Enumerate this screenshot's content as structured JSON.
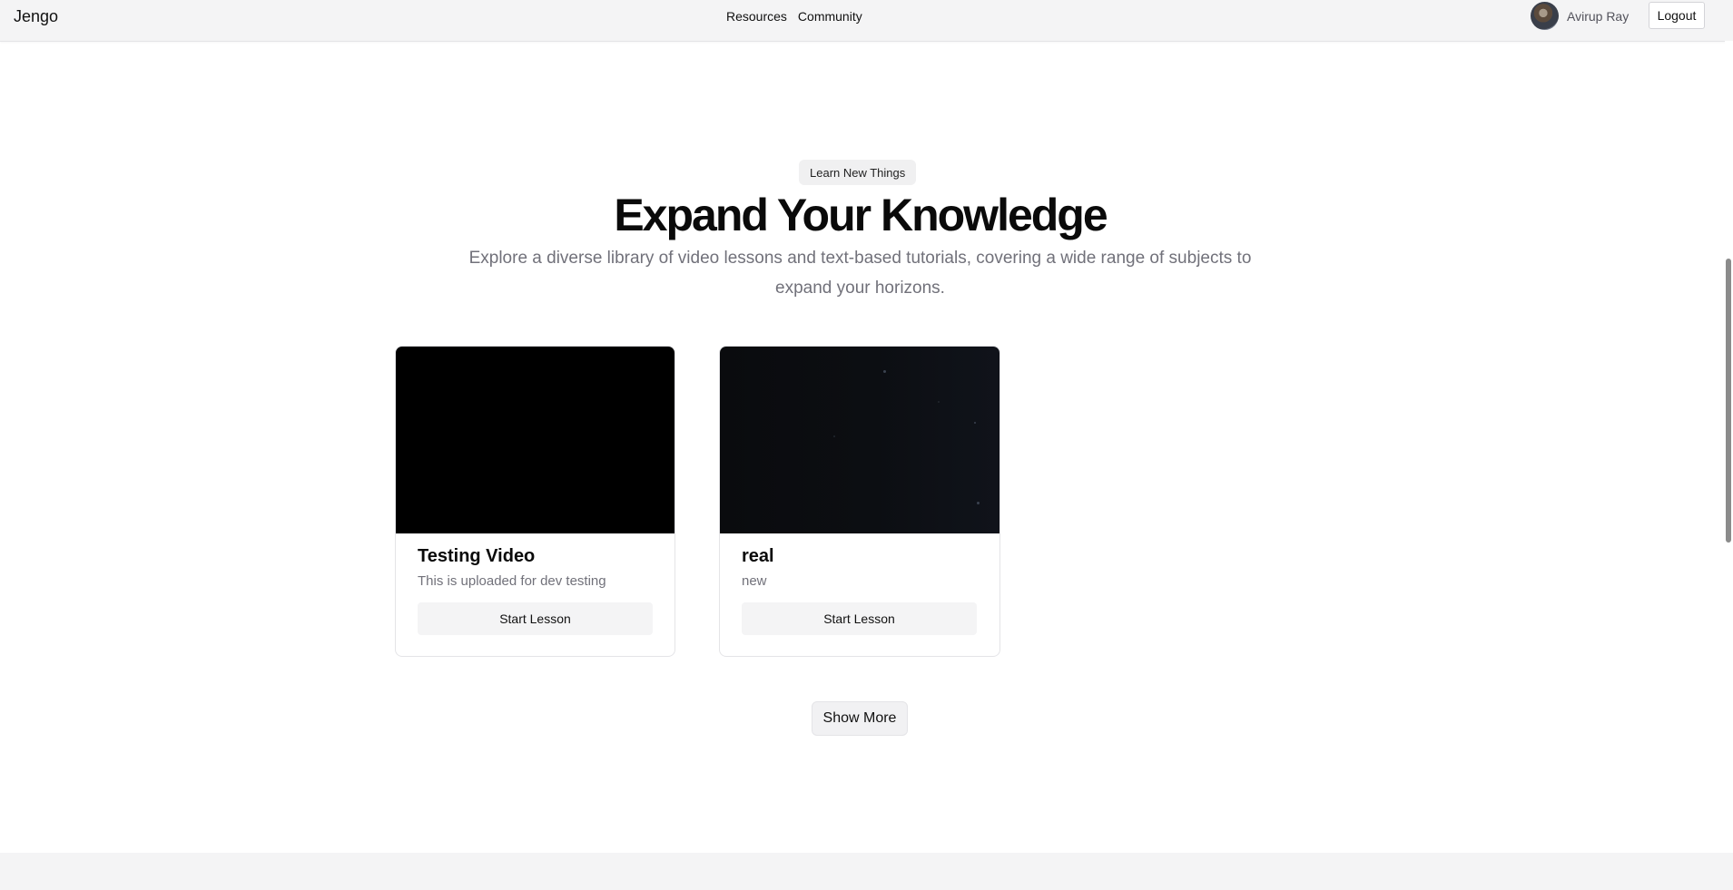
{
  "header": {
    "brand": "Jengo",
    "nav": [
      "Resources",
      "Community"
    ],
    "user_name": "Avirup Ray",
    "logout_label": "Logout"
  },
  "hero": {
    "badge": "Learn New Things",
    "title": "Expand Your Knowledge",
    "subtitle": "Explore a diverse library of video lessons and text-based tutorials, covering a wide range of subjects to expand your horizons."
  },
  "lessons": [
    {
      "title": "Testing Video",
      "description": "This is uploaded for dev testing",
      "button": "Start Lesson"
    },
    {
      "title": "real",
      "description": "new",
      "button": "Start Lesson"
    }
  ],
  "show_more_label": "Show More",
  "colors": {
    "header_bg": "#f4f4f5",
    "muted_text": "#71717a",
    "button_bg": "#f4f4f5"
  }
}
